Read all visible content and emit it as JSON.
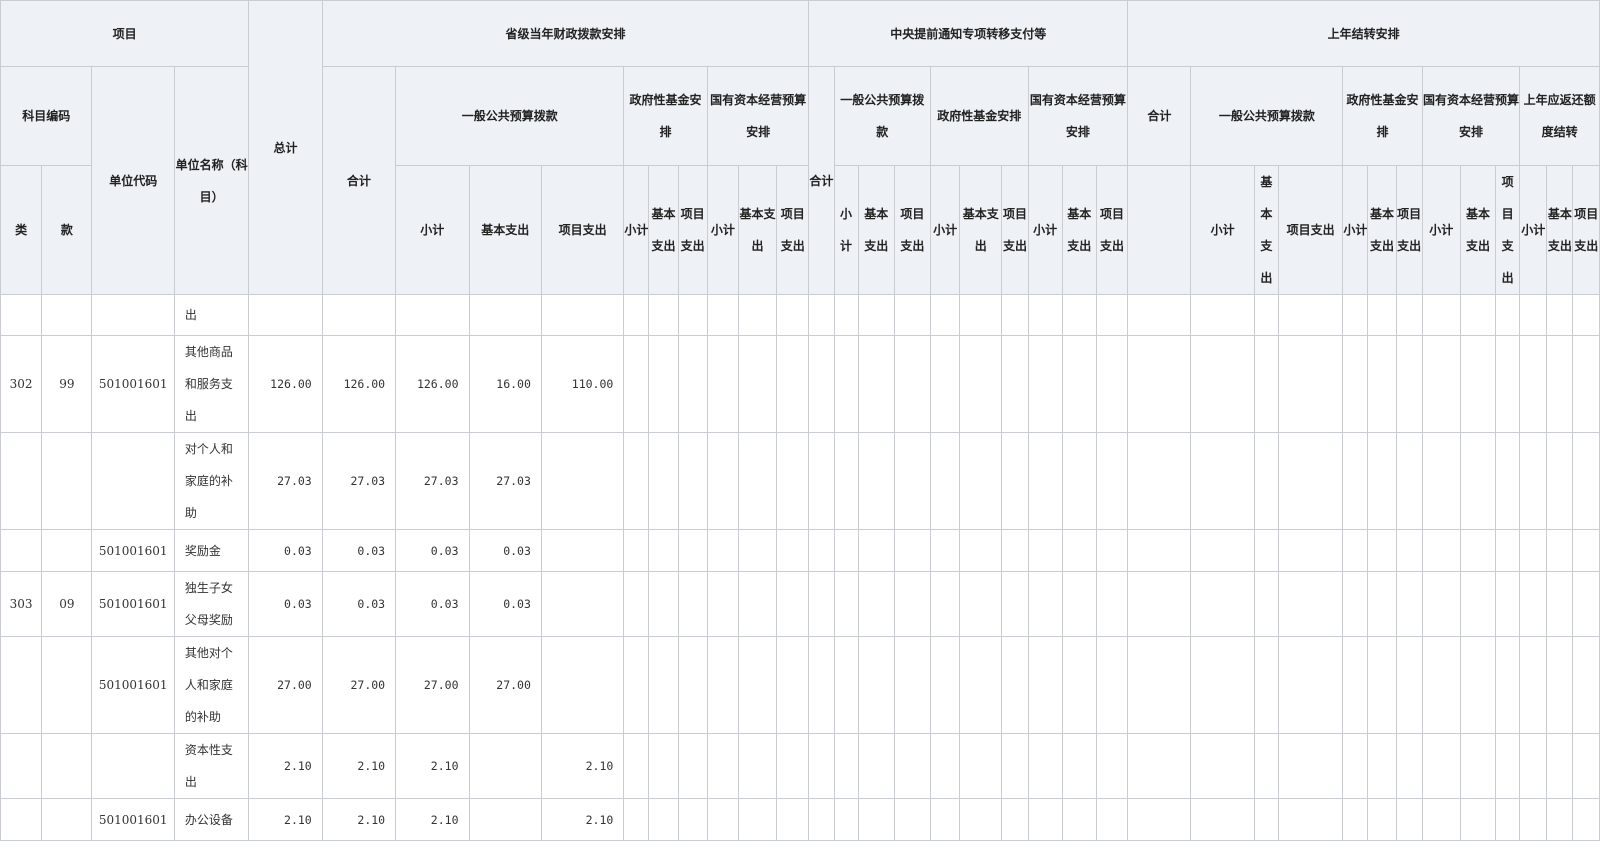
{
  "header": {
    "xiangmu": "项目",
    "kemu_bianma": "科目编码",
    "lei": "类",
    "kuan": "款",
    "danwei_daima": "单位代码",
    "danwei_mingcheng": "单位名称（科目）",
    "zongji": "总计",
    "group1": {
      "title": "省级当年财政拨款安排",
      "heji": "合计",
      "ybgg": "一般公共预算拨款",
      "xiaoji": "小计",
      "jiben": "基本支出",
      "xiangmu_zc": "项目支出",
      "zfxjj": "政府性基金安排",
      "gyzb": "国有资本经营预算安排",
      "xj": "小计",
      "jb": "基本支出",
      "xm": "项目支出"
    },
    "group2": {
      "title": "中央提前通知专项转移支付等",
      "heji": "合计",
      "ybgg": "一般公共预算拨款",
      "zfxjj": "政府性基金安排",
      "gyzb": "国有资本经营预算安排",
      "xj": "小计",
      "jb": "基本支出",
      "xm": "项目支出"
    },
    "group3": {
      "title": "上年结转安排",
      "heji": "合计",
      "ybgg": "一般公共预算拨款",
      "xiaoji": "小计",
      "jb": "基本支出",
      "xm": "项目支出",
      "zfxjj": "政府性基金安排",
      "gyzb": "国有资本经营预算安排",
      "shangnian": "上年应返还额度结转",
      "xj": "小计"
    }
  },
  "rows": [
    {
      "lei": "",
      "kuan": "",
      "code": "",
      "name": "出",
      "total": "",
      "heji": "",
      "xiaoji": "",
      "jiben": "",
      "xiangmu": ""
    },
    {
      "lei": "302",
      "kuan": "99",
      "code": "501001601",
      "name": "其他商品和服务支出",
      "total": "126.00",
      "heji": "126.00",
      "xiaoji": "126.00",
      "jiben": "16.00",
      "xiangmu": "110.00"
    },
    {
      "lei": "",
      "kuan": "",
      "code": "",
      "name": "对个人和家庭的补助",
      "total": "27.03",
      "heji": "27.03",
      "xiaoji": "27.03",
      "jiben": "27.03",
      "xiangmu": ""
    },
    {
      "lei": "",
      "kuan": "",
      "code": "501001601",
      "name": "奖励金",
      "total": "0.03",
      "heji": "0.03",
      "xiaoji": "0.03",
      "jiben": "0.03",
      "xiangmu": ""
    },
    {
      "lei": "303",
      "kuan": "09",
      "code": "501001601",
      "name": "独生子女父母奖励",
      "total": "0.03",
      "heji": "0.03",
      "xiaoji": "0.03",
      "jiben": "0.03",
      "xiangmu": ""
    },
    {
      "lei": "",
      "kuan": "",
      "code": "501001601",
      "name": "其他对个人和家庭的补助",
      "total": "27.00",
      "heji": "27.00",
      "xiaoji": "27.00",
      "jiben": "27.00",
      "xiangmu": ""
    },
    {
      "lei": "",
      "kuan": "",
      "code": "",
      "name": "资本性支出",
      "total": "2.10",
      "heji": "2.10",
      "xiaoji": "2.10",
      "jiben": "",
      "xiangmu": "2.10"
    },
    {
      "lei": "",
      "kuan": "",
      "code": "501001601",
      "name": "办公设备",
      "total": "2.10",
      "heji": "2.10",
      "xiaoji": "2.10",
      "jiben": "",
      "xiangmu": "2.10"
    }
  ]
}
